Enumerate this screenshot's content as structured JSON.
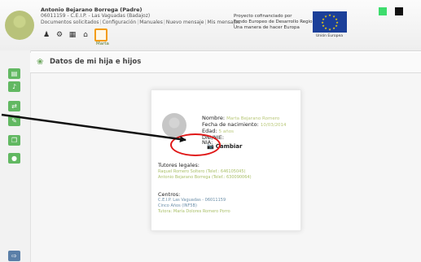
{
  "header": {
    "user_name": "Antonio Bejarano Borrega (Padre)",
    "school": "06011159 - C.E.I.P. - Las Vaguadas (Badajoz)",
    "nav_links": [
      "Documentos solicitados",
      "Configuración",
      "Manuales",
      "Nuevo mensaje",
      "Mis mensajes"
    ],
    "active_child": "Marta",
    "project_lines": [
      "Proyecto cofinanciado por",
      "Fondo Europeo de Desarrollo Regional",
      "Una manera de hacer Europa"
    ],
    "eu_caption": "Unión Europea",
    "colors": {
      "green_square": "#3ddc6d",
      "black_square": "#111111",
      "eu_blue": "#1b3f99"
    }
  },
  "page": {
    "title": "Datos de mi hija e hijos"
  },
  "child": {
    "nombre_label": "Nombre:",
    "nombre_value": "Marta Bejarano Romero",
    "fecha_label": "Fecha de nacimiento:",
    "fecha_value": "10/03/2014",
    "edad_label": "Edad:",
    "edad_value": "5 años",
    "dni_label": "DNI/NIE:",
    "nia_label": "NIA:",
    "nia_value": "...........",
    "cambiar_label": "Cambiar",
    "tutores_title": "Tutores legales:",
    "tutores": [
      "Raquel Romero Soltero (Telef.: 646105045)",
      "Antonio Bejarano Borrega (Telef.: 630090064)"
    ],
    "centros_title": "Centros:",
    "centros": [
      "C.E.I.P. Las Vaguadas - 06011159",
      "Cinco Años (INF5B)",
      "Tutora: María Dolores Romero Porro"
    ]
  },
  "icons": {
    "header": [
      "people-icon",
      "gear-icon",
      "calendar-icon",
      "home-icon",
      "child-avatar-icon"
    ],
    "sidebar": [
      "book-icon",
      "speaker-icon",
      "transfer-icon",
      "edit-icon",
      "copy-icon",
      "person-icon",
      "exit-icon"
    ]
  }
}
